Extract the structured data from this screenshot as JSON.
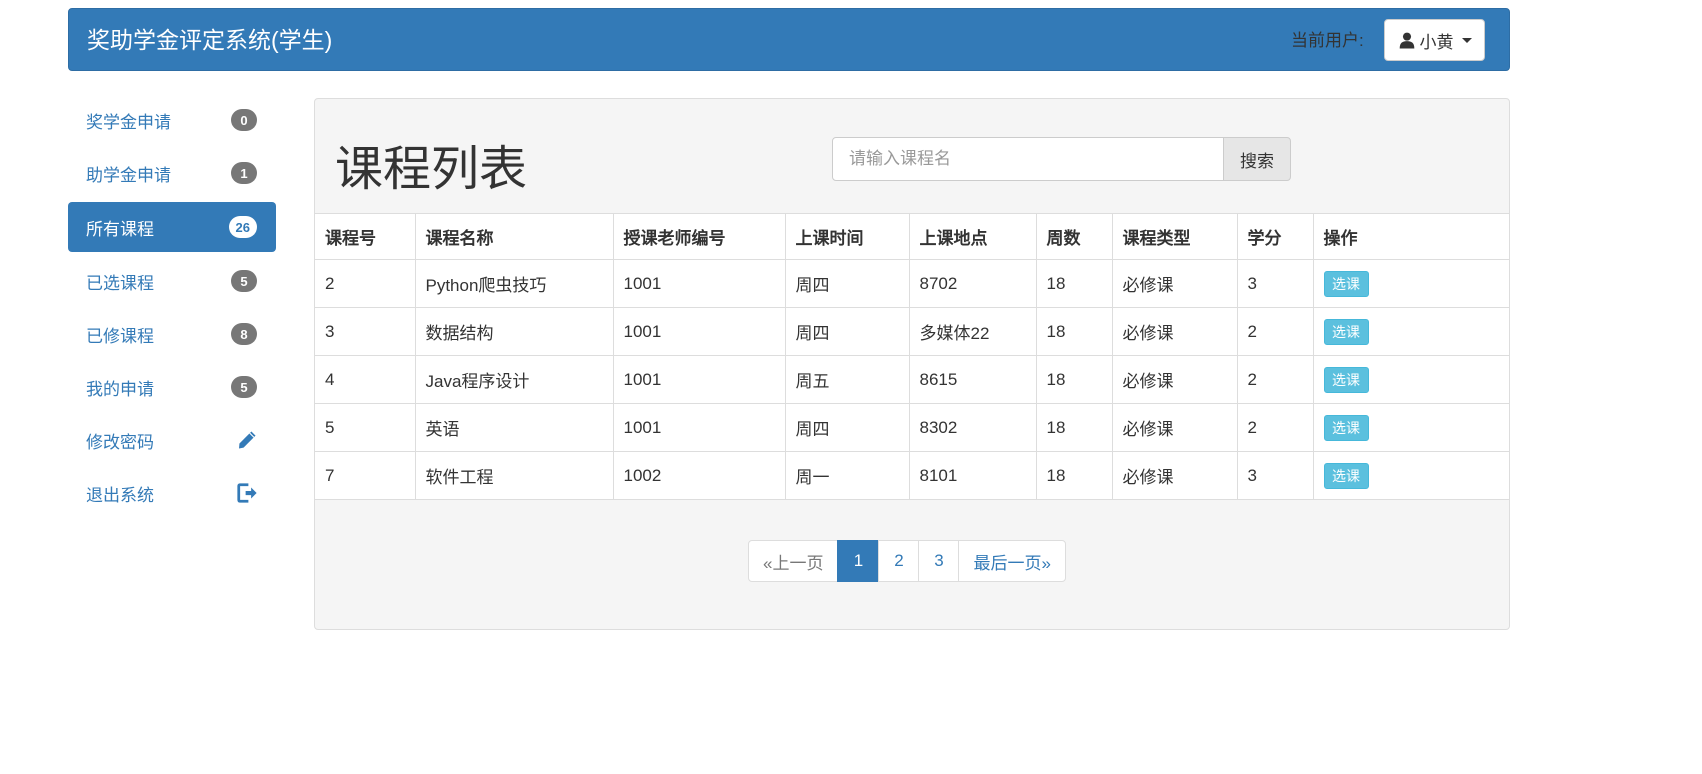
{
  "header": {
    "brand": "奖助学金评定系统(学生)",
    "current_user_label": "当前用户:",
    "user_name": "小黄"
  },
  "sidebar": {
    "items": [
      {
        "label": "奖学金申请",
        "badge": "0"
      },
      {
        "label": "助学金申请",
        "badge": "1"
      },
      {
        "label": "所有课程",
        "badge": "26"
      },
      {
        "label": "已选课程",
        "badge": "5"
      },
      {
        "label": "已修课程",
        "badge": "8"
      },
      {
        "label": "我的申请",
        "badge": "5"
      },
      {
        "label": "修改密码",
        "icon": "pencil-icon"
      },
      {
        "label": "退出系统",
        "icon": "logout-icon"
      }
    ]
  },
  "main": {
    "title": "课程列表",
    "search": {
      "placeholder": "请输入课程名",
      "value": "",
      "button": "搜索"
    },
    "table": {
      "headers": [
        "课程号",
        "课程名称",
        "授课老师编号",
        "上课时间",
        "上课地点",
        "周数",
        "课程类型",
        "学分",
        "操作"
      ],
      "rows": [
        [
          "2",
          "Python爬虫技巧",
          "1001",
          "周四",
          "8702",
          "18",
          "必修课",
          "3",
          "选课"
        ],
        [
          "3",
          "数据结构",
          "1001",
          "周四",
          "多媒体22",
          "18",
          "必修课",
          "2",
          "选课"
        ],
        [
          "4",
          "Java程序设计",
          "1001",
          "周五",
          "8615",
          "18",
          "必修课",
          "2",
          "选课"
        ],
        [
          "5",
          "英语",
          "1001",
          "周四",
          "8302",
          "18",
          "必修课",
          "2",
          "选课"
        ],
        [
          "7",
          "软件工程",
          "1002",
          "周一",
          "8101",
          "18",
          "必修课",
          "3",
          "选课"
        ]
      ]
    },
    "pagination": {
      "prev": "«上一页",
      "pages": [
        "1",
        "2",
        "3"
      ],
      "current": "1",
      "last": "最后一页»"
    }
  },
  "colors": {
    "primary": "#337ab7",
    "info": "#5bc0de",
    "badge": "#777777"
  }
}
